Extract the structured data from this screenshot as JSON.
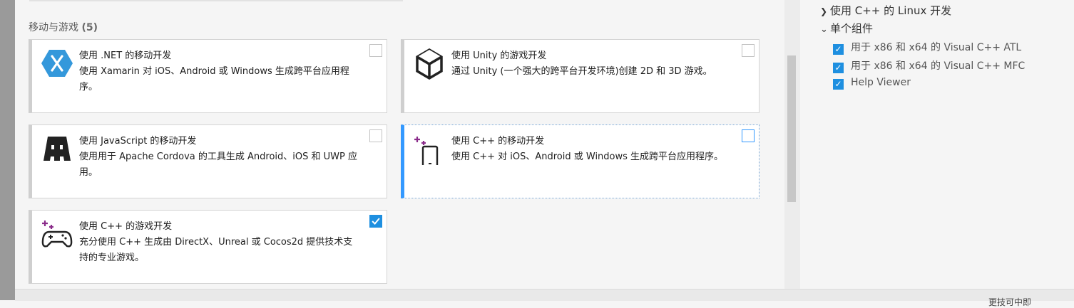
{
  "section": {
    "title": "移动与游戏",
    "count": "(5)"
  },
  "cards": [
    {
      "title": "使用 .NET 的移动开发",
      "desc": "使用 Xamarin 对 iOS、Android 或 Windows 生成跨平台应用程序。",
      "icon": "xamarin-icon",
      "checked": false
    },
    {
      "title": "使用 Unity 的游戏开发",
      "desc": "通过 Unity (一个强大的跨平台开发环境)创建 2D 和 3D 游戏。",
      "icon": "unity-icon",
      "checked": false
    },
    {
      "title": "使用 JavaScript 的移动开发",
      "desc": "使用用于 Apache Cordova 的工具生成 Android、iOS 和 UWP 应用。",
      "icon": "cordova-icon",
      "checked": false
    },
    {
      "title": "使用 C++ 的移动开发",
      "desc": "使用 C++ 对 iOS、Android 或 Windows 生成跨平台应用程序。",
      "icon": "mobile-cpp-icon",
      "checked": false,
      "focused": true
    },
    {
      "title": "使用 C++ 的游戏开发",
      "desc": "充分使用 C++ 生成由 DirectX、Unreal 或 Cocos2d 提供技术支持的专业游戏。",
      "icon": "gamepad-icon",
      "checked": true
    }
  ],
  "summary": {
    "linux_item": "使用 C++ 的 Linux 开发",
    "components_header": "单个组件",
    "components": [
      "用于 x86 和 x64 的 Visual C++ ATL",
      "用于 x86 和 x64 的 Visual C++ MFC",
      "Help Viewer"
    ]
  },
  "footer": {
    "partial_text": "更技可中即"
  },
  "colors": {
    "accent": "#1e8fe0",
    "selected_border": "#3399ff"
  }
}
